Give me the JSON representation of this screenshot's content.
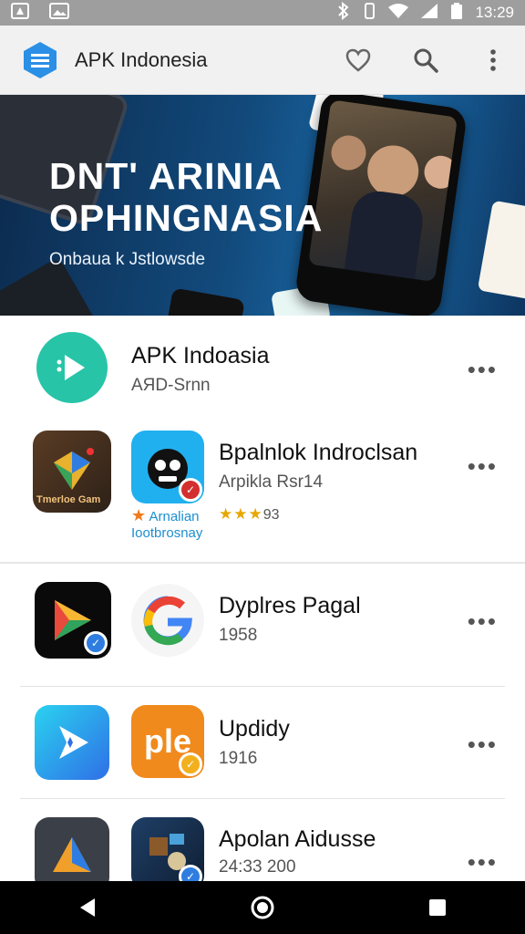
{
  "status_bar": {
    "time": "13:29",
    "icons": [
      "notification-icon",
      "image-icon",
      "bluetooth-icon",
      "vibrate-icon",
      "wifi-icon",
      "signal-icon",
      "battery-icon"
    ]
  },
  "app_bar": {
    "title": "APK Indonesia",
    "actions": [
      "heart-icon",
      "search-icon",
      "more-vert-icon"
    ]
  },
  "banner": {
    "headline_line1": "DNT' ARINIA",
    "headline_line2": "OPHINGNASIA",
    "subtitle": "Onbaua k Jstlowsde"
  },
  "apps": [
    {
      "title": "APK Indoasia",
      "subtitle": "AЯD-Srnn",
      "icon": "play-circle-icon"
    },
    {
      "title": "Bpalnlok Indroclsan",
      "subtitle": "Arpikla Rsr14",
      "rating": "93",
      "stars": "★★★",
      "icon": "face-app-icon",
      "promo_icon": "thumbnail-icon",
      "promo_label_line1": "Arnalian",
      "promo_label_line2": "Iootbrosnay",
      "promo_thumb_text": "Tmerloe Gam"
    },
    {
      "title": "Dyplres Pagal",
      "subtitle": "1958",
      "icon": "google-icon",
      "left_icon": "play-store-icon"
    },
    {
      "title": "Updidy",
      "subtitle": "1916",
      "icon_text": "ple",
      "icon": "ple-app-icon",
      "left_icon": "star-arrow-icon"
    },
    {
      "title": "Apolan Aidusse",
      "subtitle": "24:33 200",
      "icon": "game-icon",
      "left_icon": "triangle-logo-icon"
    }
  ],
  "more_label": "•••",
  "nav_bar": [
    "back-icon",
    "home-icon",
    "recents-icon"
  ],
  "colors": {
    "status_bar": "#9e9e9e",
    "app_bar": "#f1f1f1",
    "accent": "#2f7de1",
    "nav_bar": "#000000"
  }
}
